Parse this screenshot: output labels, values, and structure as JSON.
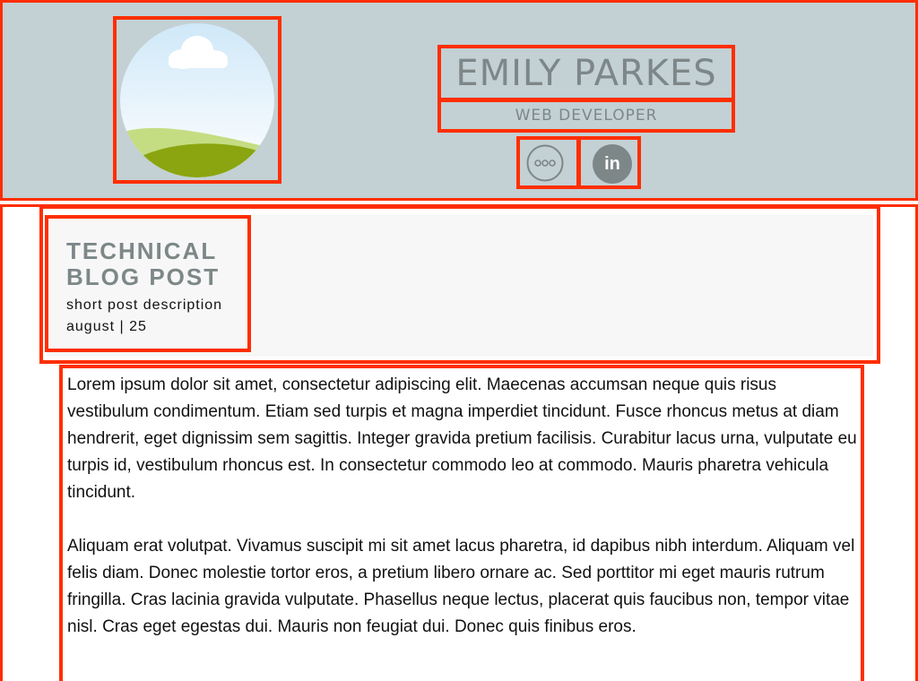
{
  "profile": {
    "name": "EMILY PARKES",
    "role": "WEB DEVELOPER",
    "social": [
      {
        "icon": "more-icon"
      },
      {
        "icon": "linkedin-icon",
        "label": "in"
      }
    ]
  },
  "post": {
    "title": "TECHNICAL BLOG POST",
    "description": "short post description",
    "date": "august | 25",
    "paragraphs": [
      "Lorem ipsum dolor sit amet, consectetur adipiscing elit. Maecenas accumsan neque quis risus vestibulum condimentum. Etiam sed turpis et magna imperdiet tincidunt. Fusce rhoncus metus at diam hendrerit, eget dignissim sem sagittis. Integer gravida pretium facilisis. Curabitur lacus urna, vulputate eu turpis id, vestibulum rhoncus est. In consectetur commodo leo at commodo. Mauris pharetra vehicula tincidunt.",
      "Aliquam erat volutpat. Vivamus suscipit mi sit amet lacus pharetra, id dapibus nibh interdum. Aliquam vel felis diam. Donec molestie tortor eros, a pretium libero ornare ac. Sed porttitor mi eget mauris rutrum fringilla. Cras lacinia gravida vulputate. Phasellus neque lectus, placerat quis faucibus non, tempor vitae nisl. Cras eget egestas dui. Mauris non feugiat dui. Donec quis finibus eros."
    ]
  },
  "colors": {
    "header_bg": "#c3d0d4",
    "accent_text": "#7d8788",
    "annotation_border": "#ff2e00",
    "post_header_bg": "#f7f7f7"
  }
}
